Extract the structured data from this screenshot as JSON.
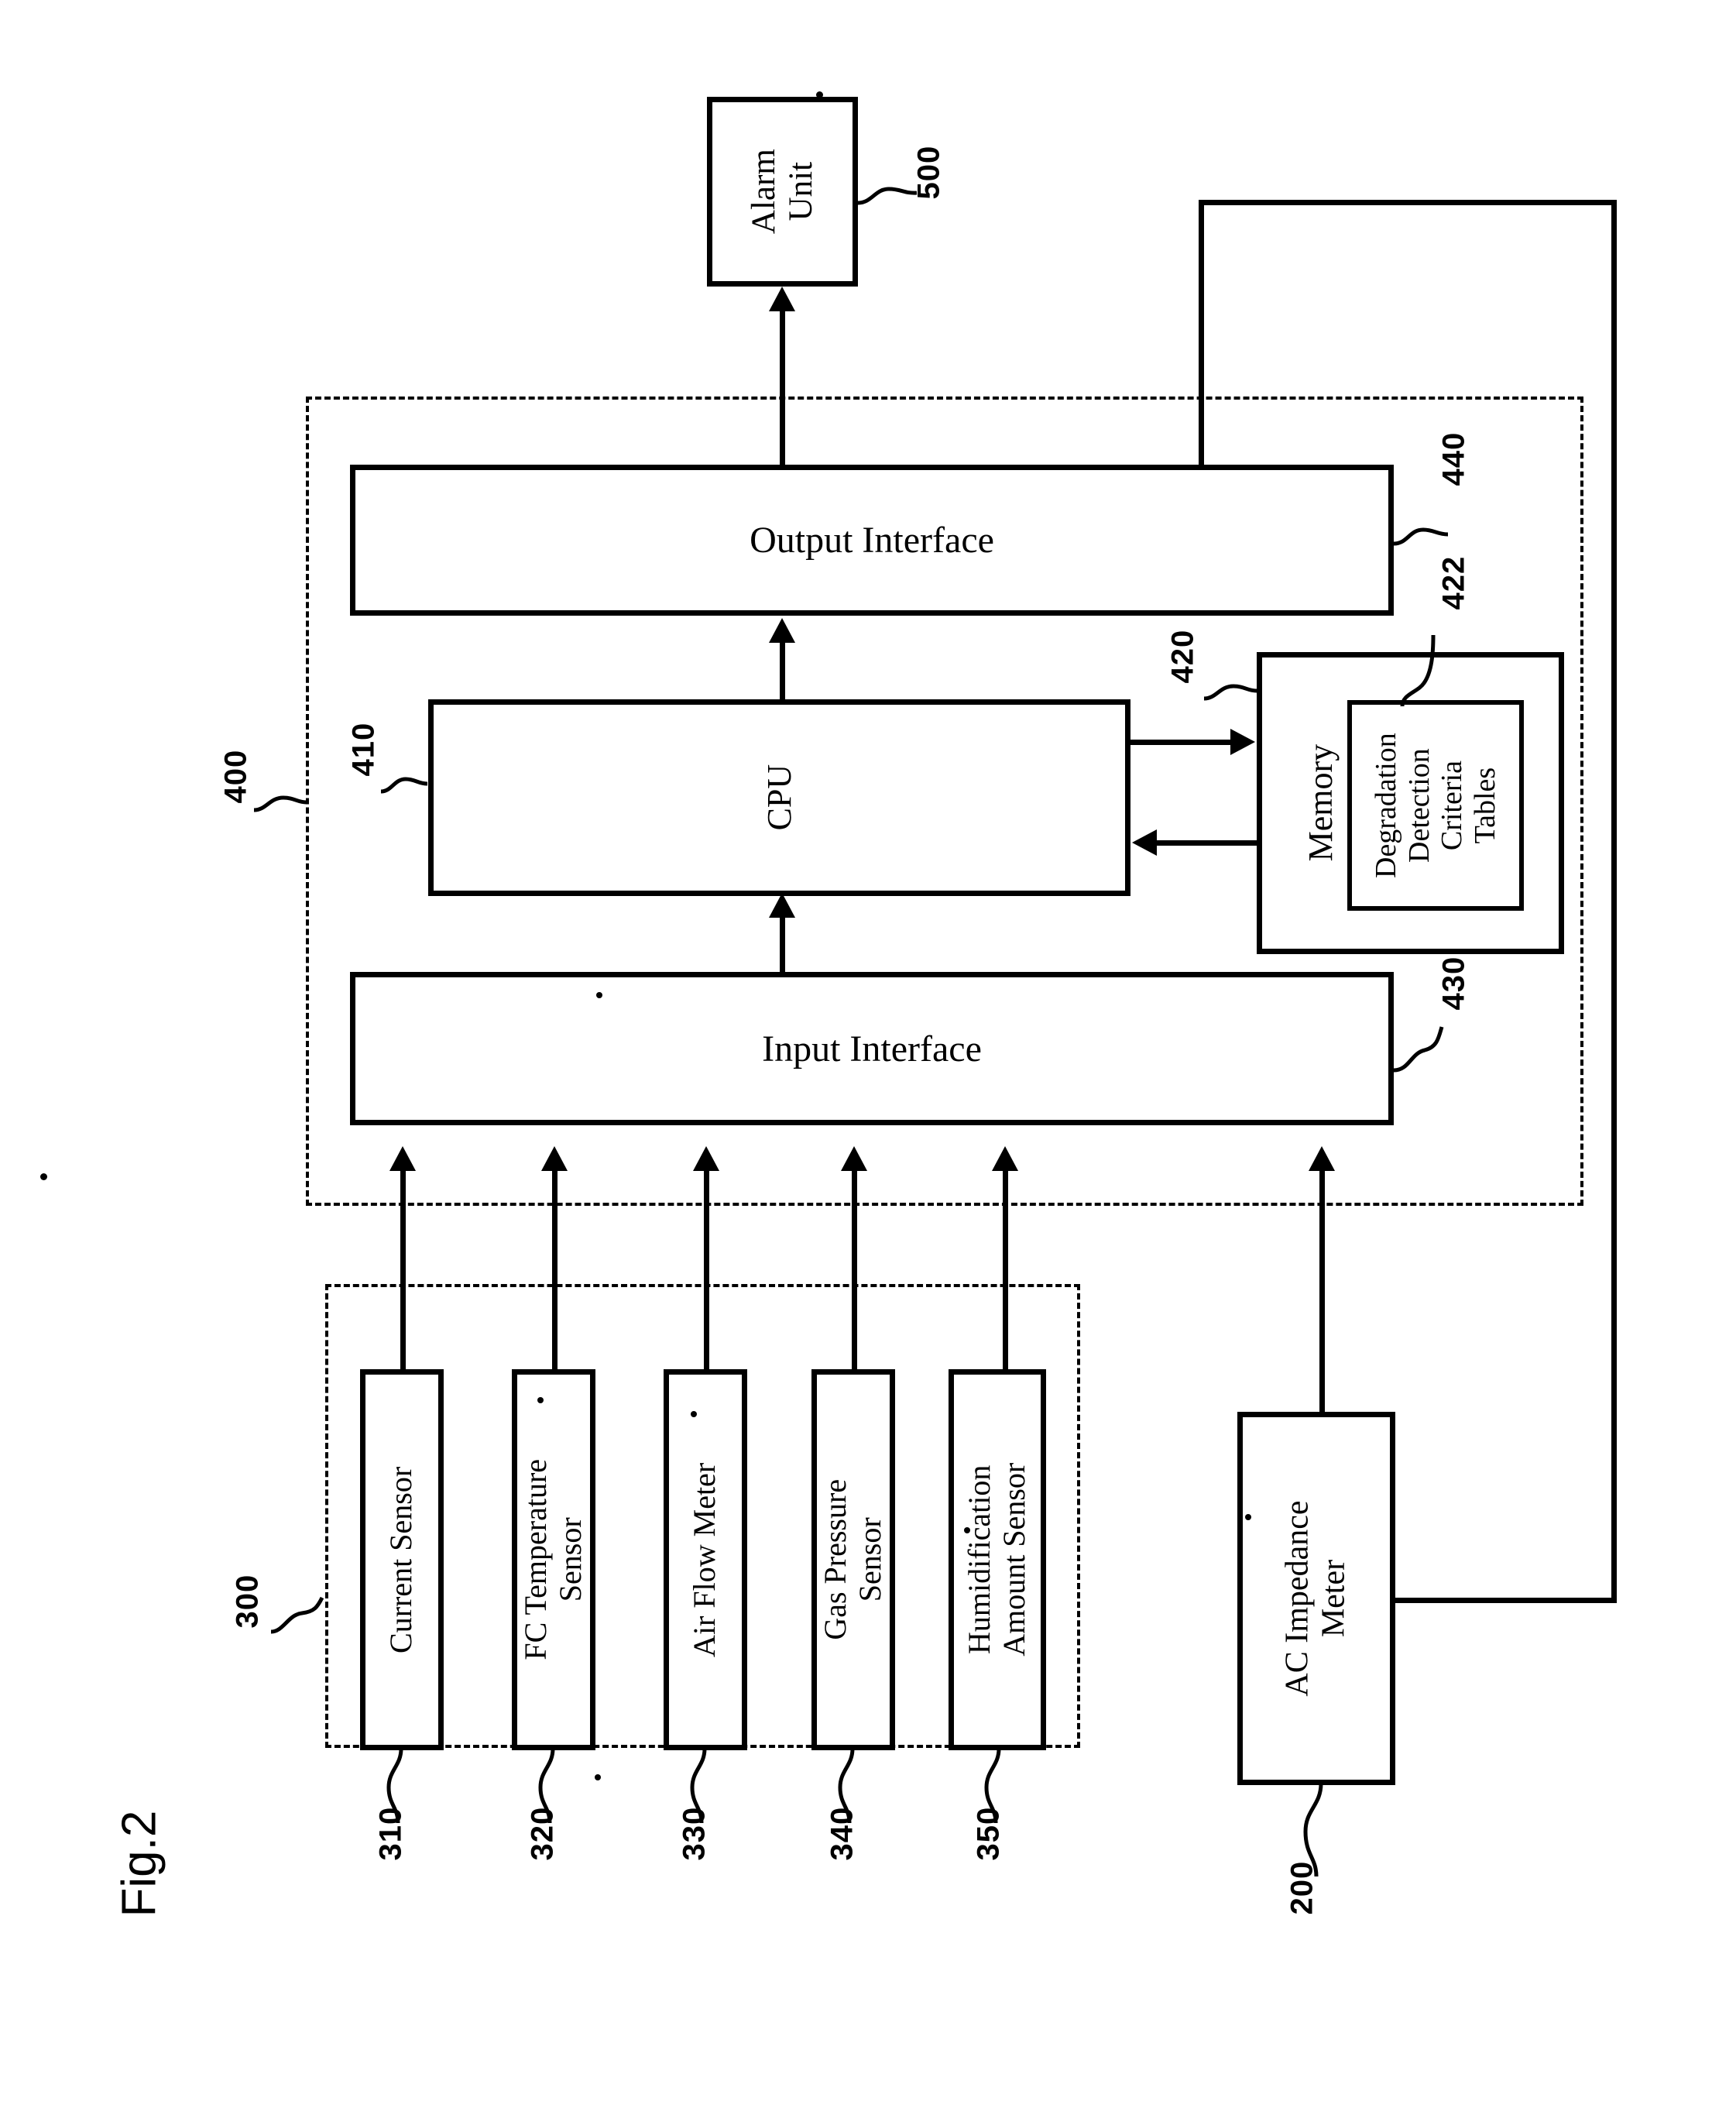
{
  "figure": {
    "label": "Fig.2",
    "type": "patent-block-diagram"
  },
  "blocks": {
    "alarm_unit": {
      "label": "Alarm\nUnit",
      "line1": "Alarm",
      "line2": "Unit",
      "ref": "500"
    },
    "output_interface": {
      "label": "Output Interface",
      "ref": "440"
    },
    "cpu": {
      "label": "CPU",
      "ref": "410"
    },
    "memory": {
      "label": "Memory",
      "ref": "420"
    },
    "criteria_tables": {
      "label": "Degradation Detection Criteria Tables",
      "line1": "Degradation",
      "line2": "Detection",
      "line3": "Criteria",
      "line4": "Tables",
      "ref": "422"
    },
    "input_interface": {
      "label": "Input Interface",
      "ref": "430"
    },
    "control_unit": {
      "ref": "400"
    },
    "sensor_group": {
      "ref": "300"
    },
    "ac_impedance_meter": {
      "line1": "AC Impedance",
      "line2": "Meter",
      "ref": "200"
    }
  },
  "sensors": [
    {
      "line1": "Current Sensor",
      "line2": "",
      "ref": "310"
    },
    {
      "line1": "FC Temperature",
      "line2": "Sensor",
      "ref": "320"
    },
    {
      "line1": "Air Flow Meter",
      "line2": "",
      "ref": "330"
    },
    {
      "line1": "Gas Pressure",
      "line2": "Sensor",
      "ref": "340"
    },
    {
      "line1": "Humidification",
      "line2": "Amount Sensor",
      "ref": "350"
    }
  ],
  "colors": {
    "ink": "#000000",
    "paper": "#ffffff"
  }
}
